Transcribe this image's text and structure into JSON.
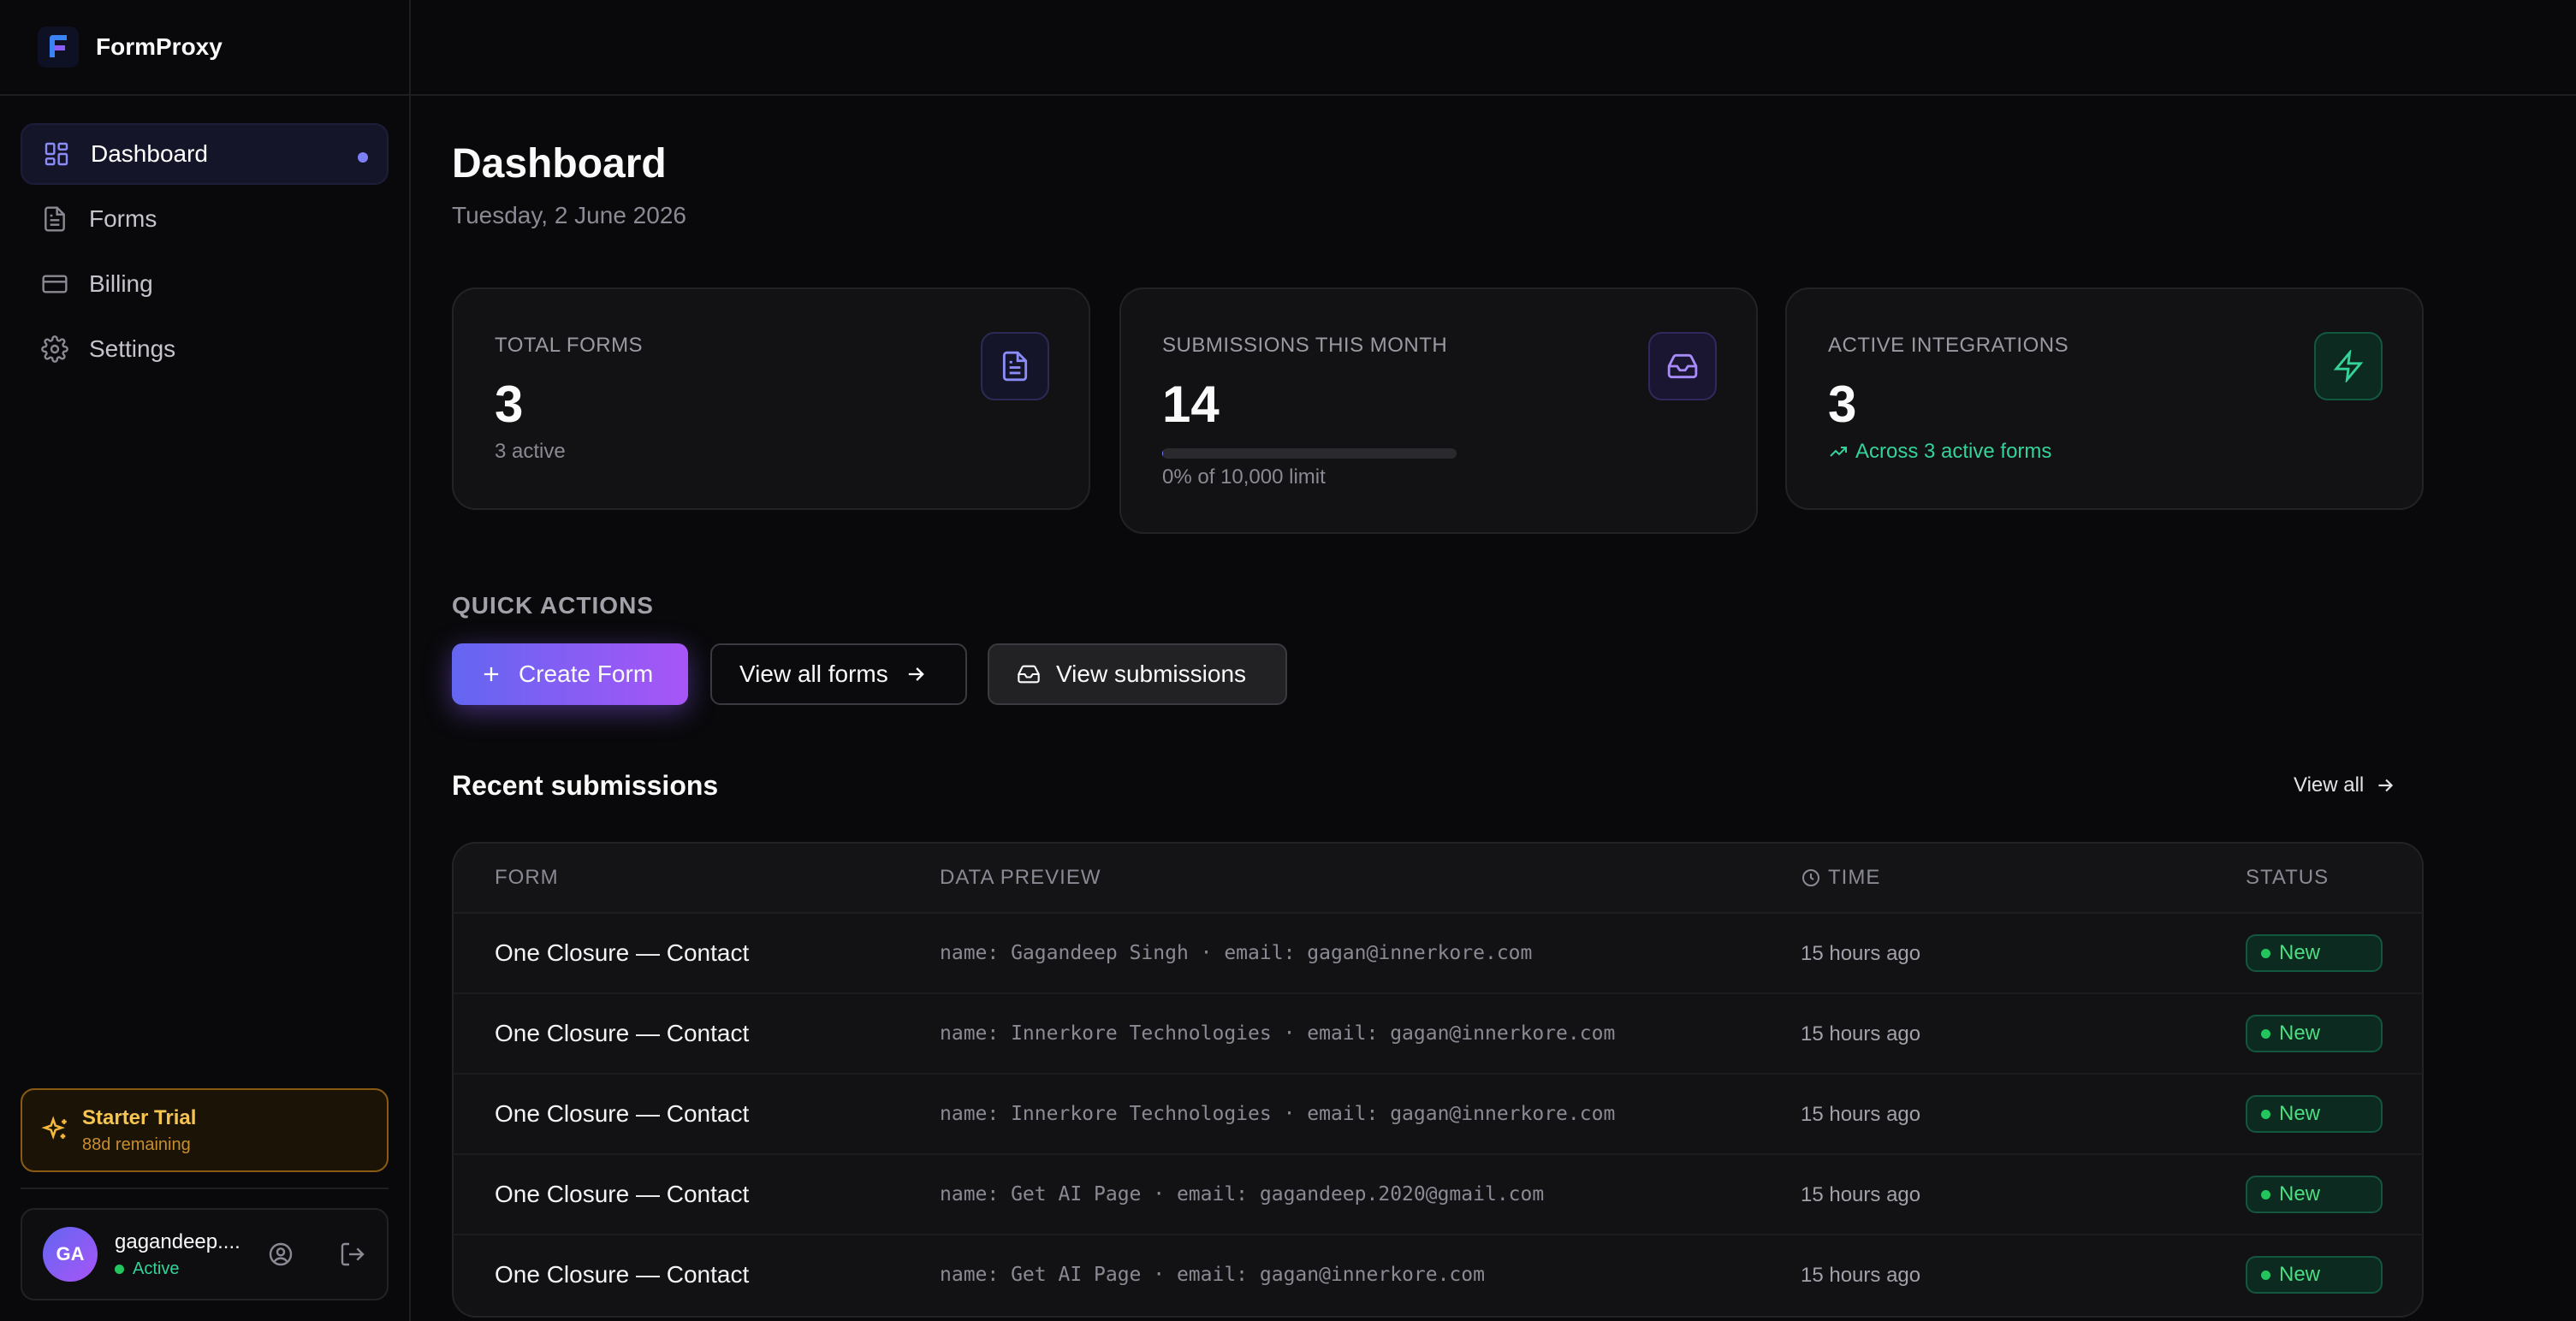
{
  "app": {
    "name": "FormProxy"
  },
  "sidebar": {
    "items": [
      {
        "label": "Dashboard",
        "icon": "dashboard-icon",
        "active": true
      },
      {
        "label": "Forms",
        "icon": "file-icon",
        "active": false
      },
      {
        "label": "Billing",
        "icon": "credit-card-icon",
        "active": false
      },
      {
        "label": "Settings",
        "icon": "gear-icon",
        "active": false
      }
    ],
    "trial": {
      "title": "Starter Trial",
      "remaining": "88d remaining",
      "icon": "sparkles-icon"
    },
    "user": {
      "initials": "GA",
      "name": "gagandeep....",
      "status": "Active"
    }
  },
  "page": {
    "title": "Dashboard",
    "date": "Tuesday, 2 June 2026"
  },
  "stats": [
    {
      "label": "TOTAL FORMS",
      "value": "3",
      "sub": "3 active",
      "icon": "file-icon",
      "color": "#8b8cf8"
    },
    {
      "label": "SUBMISSIONS THIS MONTH",
      "value": "14",
      "sub": "0% of 10,000 limit",
      "progress": 0.0014,
      "icon": "inbox-icon",
      "color": "#a78bfa"
    },
    {
      "label": "ACTIVE INTEGRATIONS",
      "value": "3",
      "sub": "Across 3 active forms",
      "icon": "lightning-icon",
      "color": "#34d399"
    }
  ],
  "quick_actions": {
    "label": "QUICK ACTIONS",
    "create": "Create Form",
    "view_forms": "View all forms",
    "view_submissions": "View submissions"
  },
  "recent": {
    "title": "Recent submissions",
    "view_all": "View all",
    "columns": [
      "FORM",
      "DATA PREVIEW",
      "TIME",
      "STATUS"
    ],
    "rows": [
      {
        "form": "One Closure — Contact",
        "preview": "name: Gagandeep Singh · email: gagan@innerkore.com",
        "time": "15 hours ago",
        "status": "New"
      },
      {
        "form": "One Closure — Contact",
        "preview": "name: Innerkore Technologies · email: gagan@innerkore.com",
        "time": "15 hours ago",
        "status": "New"
      },
      {
        "form": "One Closure — Contact",
        "preview": "name: Innerkore Technologies · email: gagan@innerkore.com",
        "time": "15 hours ago",
        "status": "New"
      },
      {
        "form": "One Closure — Contact",
        "preview": "name: Get AI Page · email: gagandeep.2020@gmail.com",
        "time": "15 hours ago",
        "status": "New"
      },
      {
        "form": "One Closure — Contact",
        "preview": "name: Get AI Page · email: gagan@innerkore.com",
        "time": "15 hours ago",
        "status": "New"
      }
    ]
  },
  "colors": {
    "accent": "#6366f1",
    "accent_end": "#a855f7",
    "success": "#22c55e",
    "warning": "#f5b83d"
  }
}
